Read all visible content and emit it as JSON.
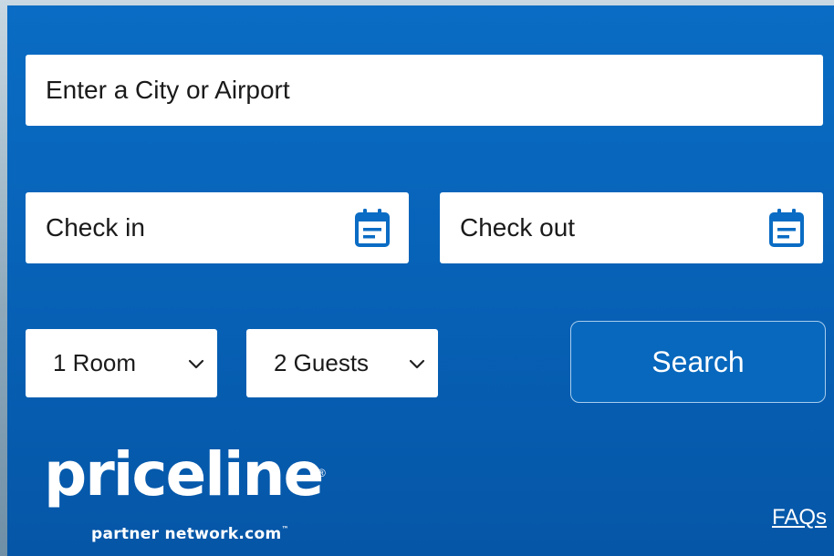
{
  "search": {
    "destination_placeholder": "Enter a City or Airport",
    "check_in_placeholder": "Check in",
    "check_out_placeholder": "Check out",
    "rooms_value": "1 Room",
    "guests_value": "2 Guests",
    "search_label": "Search"
  },
  "icons": {
    "calendar": "calendar-icon",
    "dropdown": "chevron-down-icon"
  },
  "brand": {
    "name": "priceline",
    "registered_mark": "®",
    "tagline": "partner network.com",
    "trademark": "™"
  },
  "footer": {
    "faqs_label": "FAQs"
  },
  "colors": {
    "widget_background": "#0763b8",
    "icon_accent": "#0a6cc4",
    "search_button": "#0768bd",
    "search_button_border": "#a8cdee",
    "text_white": "#ffffff"
  }
}
